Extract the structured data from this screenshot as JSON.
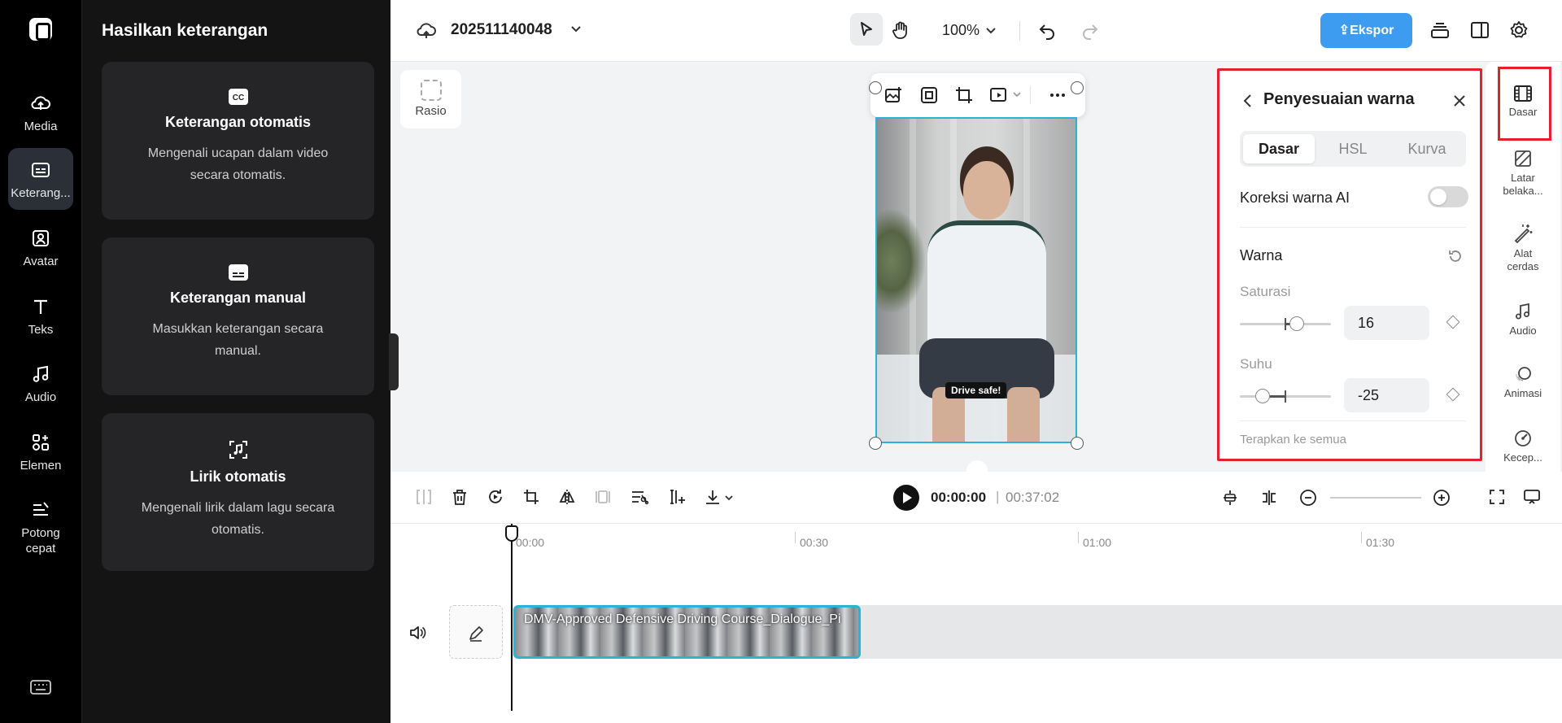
{
  "rail": {
    "items": [
      {
        "label": "Media",
        "icon": "cloud-upload-icon"
      },
      {
        "label": "Keterang...",
        "icon": "captions-icon",
        "active": true
      },
      {
        "label": "Avatar",
        "icon": "avatar-icon"
      },
      {
        "label": "Teks",
        "icon": "text-icon"
      },
      {
        "label": "Audio",
        "icon": "music-note-icon"
      },
      {
        "label": "Elemen",
        "icon": "elements-icon"
      },
      {
        "label": "Potong",
        "label2": "cepat",
        "icon": "quick-cut-icon"
      }
    ]
  },
  "captions_panel": {
    "title": "Hasilkan keterangan",
    "cards": [
      {
        "title": "Keterangan otomatis",
        "desc1": "Mengenali ucapan dalam video",
        "desc2": "secara otomatis.",
        "icon": "cc-icon"
      },
      {
        "title": "Keterangan manual",
        "desc1": "Masukkan keterangan secara",
        "desc2": "manual.",
        "icon": "subtitle-box-icon"
      },
      {
        "title": "Lirik otomatis",
        "desc1": "Mengenali lirik dalam lagu secara",
        "desc2": "otomatis.",
        "icon": "lyrics-icon"
      }
    ]
  },
  "topbar": {
    "project_name": "202511140048",
    "zoom": "100%",
    "export_label": "Ekspor"
  },
  "canvas": {
    "ratio_label": "Rasio",
    "subtitle_text": "Drive safe!"
  },
  "color_panel": {
    "title": "Penyesuaian warna",
    "tabs": [
      "Dasar",
      "HSL",
      "Kurva"
    ],
    "active_tab": "Dasar",
    "ai_label": "Koreksi warna AI",
    "ai_enabled": false,
    "section_label": "Warna",
    "saturation": {
      "label": "Saturasi",
      "value": "16"
    },
    "temperature": {
      "label": "Suhu",
      "value": "-25"
    },
    "apply_all": "Terapkan ke semua"
  },
  "prop_rail": {
    "items": [
      {
        "label": "Dasar",
        "icon": "film-icon"
      },
      {
        "label": "Latar",
        "label2": "belaka...",
        "icon": "background-icon"
      },
      {
        "label": "Alat",
        "label2": "cerdas",
        "icon": "magic-wand-icon"
      },
      {
        "label": "Audio",
        "icon": "music-note-icon"
      },
      {
        "label": "Animasi",
        "icon": "animation-icon"
      },
      {
        "label": "Kecep...",
        "icon": "speed-icon"
      }
    ]
  },
  "timeline": {
    "current_time": "00:00:00",
    "total_time": "00:37:02",
    "separator": "|",
    "ruler": [
      "00:00",
      "00:30",
      "01:00",
      "01:30"
    ],
    "clip_name": "DMV-Approved Defensive Driving Course_Dialogue_Pi"
  },
  "colors": {
    "accent": "#3d9bf0",
    "selection": "#2ab4d4",
    "highlight": "#e3202f"
  }
}
